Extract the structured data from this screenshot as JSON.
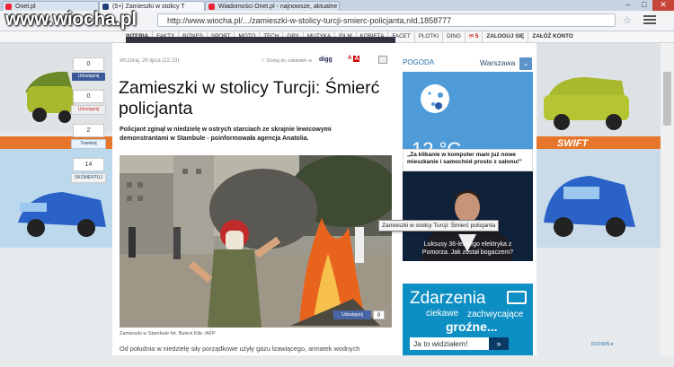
{
  "browser": {
    "tabs": [
      {
        "label": "Onet.pl",
        "active": false
      },
      {
        "label": "(5+) Zamieszki w stolicy T",
        "active": true
      },
      {
        "label": "Wiadomości Onet.pl - najnowsze, aktualne",
        "active": false
      }
    ],
    "url": "http://www.wiocha.pl/.../zamieszki-w-stolicy-turcji-smierc-policjanta,nId,1858777",
    "watermark": "www.wiocha.pl"
  },
  "site_nav": {
    "items": [
      "INTERIA",
      "FAKTY",
      "BIZNES",
      "SPORT",
      "MOTO",
      "TECH",
      "GRY",
      "MUZYKA",
      "FILM",
      "KOBIETA",
      "FACET",
      "PLOTKI",
      "DING"
    ],
    "mail_count": "5",
    "login": "ZALOGUJ SIĘ",
    "register": "ZAŁÓŻ KONTO"
  },
  "share": {
    "facebook_count": "0",
    "facebook_label": "Udostępnij",
    "gplus_count": "0",
    "gplus_label": "Udostępnij",
    "twitter_count": "2",
    "twitter_label": "Tweetnij",
    "comments_count": "14",
    "comments_label": "SKOMENTUJ"
  },
  "article": {
    "date": "Wczoraj, 26 lipca (22:23)",
    "bookmark": "Dodaj do zakładek w",
    "digg": "digg",
    "font_small": "A",
    "font_large": "A",
    "title": "Zamieszki w stolicy Turcji: Śmierć policjanta",
    "lead": "Policjant zginął w niedzielę w ostrych starciach ze skrajnie lewicowymi demonstrantami w Stambule - poinformowała agencja Anatolia.",
    "caption": "Zamieszki w Stambule fot. Bulent Kilic /AFP",
    "photo_share_label": "Udostępnij",
    "photo_share_count": "0",
    "body_start": "Od południa w niedzielę siły porządkowe użyły gazu łzawiącego, armatek wodnych"
  },
  "sidebar": {
    "weather_title": "POGODA",
    "city": "Warszawa",
    "temperature": "12 °C",
    "ad1_header": "„Za klikanie w komputer mam już nowe mieszkanie i samochód prosto z salonu!”",
    "ad1_caption": "Luksusy 36-letniego elektryka z Pomorza. Jak został bogaczem?",
    "tooltip": "Zamieszki w stolicy Turcji: Śmierć policjanta",
    "ad2_line1": "Zdarzenia",
    "ad2_line2a": "ciekawe",
    "ad2_line2b": "zachwycające",
    "ad2_line3": "groźne...",
    "ad2_cta": "Ja to widziałem!",
    "ad2_arrow": "»",
    "expand_link": "ROZWIŃ ▾"
  },
  "background_ads": {
    "swift_label": "SWIFT",
    "left_car_label": "SWIFT"
  }
}
